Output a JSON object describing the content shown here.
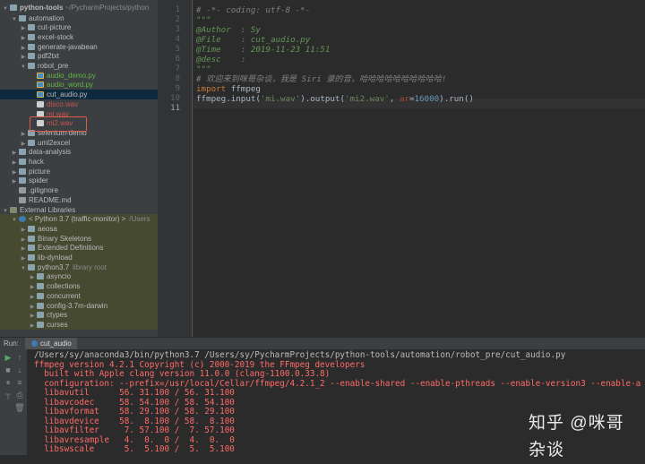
{
  "project": {
    "root": {
      "name": "python-tools",
      "path": "~/PycharmProjects/python"
    },
    "tree": [
      {
        "label": "automation",
        "indent": 1,
        "kind": "folder",
        "open": true
      },
      {
        "label": "cut-picture",
        "indent": 2,
        "kind": "folder",
        "open": false
      },
      {
        "label": "excel-stock",
        "indent": 2,
        "kind": "folder",
        "open": false
      },
      {
        "label": "generate-javabean",
        "indent": 2,
        "kind": "folder",
        "open": false
      },
      {
        "label": "pdf2txt",
        "indent": 2,
        "kind": "folder",
        "open": false
      },
      {
        "label": "robot_pre",
        "indent": 2,
        "kind": "folder",
        "open": true
      },
      {
        "label": "audio_demo.py",
        "indent": 3,
        "kind": "py",
        "color": "green"
      },
      {
        "label": "audio_word.py",
        "indent": 3,
        "kind": "py",
        "color": "green"
      },
      {
        "label": "cut_audio.py",
        "indent": 3,
        "kind": "py",
        "color": "normal",
        "selected": true
      },
      {
        "label": "disco.wav",
        "indent": 3,
        "kind": "wav",
        "color": "red"
      },
      {
        "label": "mi.wav",
        "indent": 3,
        "kind": "wav",
        "color": "red"
      },
      {
        "label": "mi2.wav",
        "indent": 3,
        "kind": "wav",
        "color": "red"
      },
      {
        "label": "selenium-demo",
        "indent": 2,
        "kind": "folder",
        "open": false
      },
      {
        "label": "uml2excel",
        "indent": 2,
        "kind": "folder",
        "open": false
      },
      {
        "label": "data-analysis",
        "indent": 1,
        "kind": "folder",
        "open": false
      },
      {
        "label": "hack",
        "indent": 1,
        "kind": "folder",
        "open": false
      },
      {
        "label": "picture",
        "indent": 1,
        "kind": "folder",
        "open": false
      },
      {
        "label": "spider",
        "indent": 1,
        "kind": "folder",
        "open": false
      },
      {
        "label": ".gitignore",
        "indent": 1,
        "kind": "txt",
        "leaf": true
      },
      {
        "label": "README.md",
        "indent": 1,
        "kind": "txt",
        "leaf": true
      },
      {
        "label": "External Libraries",
        "indent": 0,
        "kind": "lib",
        "open": true
      },
      {
        "label": "< Python 3.7 (traffic-monitor) >",
        "extra": "/Users",
        "indent": 1,
        "kind": "pyenv",
        "open": true
      },
      {
        "label": "aeosa",
        "indent": 2,
        "kind": "folder",
        "open": false
      },
      {
        "label": "Binary Skeletons",
        "indent": 2,
        "kind": "folder",
        "open": false
      },
      {
        "label": "Extended Definitions",
        "indent": 2,
        "kind": "folder",
        "open": false
      },
      {
        "label": "lib-dynload",
        "indent": 2,
        "kind": "folder",
        "open": false
      },
      {
        "label": "python3.7",
        "extra": "library root",
        "indent": 2,
        "kind": "folder",
        "open": true
      },
      {
        "label": "asyncio",
        "indent": 3,
        "kind": "folder",
        "open": false
      },
      {
        "label": "collections",
        "indent": 3,
        "kind": "folder",
        "open": false
      },
      {
        "label": "concurrent",
        "indent": 3,
        "kind": "folder",
        "open": false
      },
      {
        "label": "config-3.7m-darwin",
        "indent": 3,
        "kind": "folder",
        "open": false
      },
      {
        "label": "ctypes",
        "indent": 3,
        "kind": "folder",
        "open": false
      },
      {
        "label": "curses",
        "indent": 3,
        "kind": "folder",
        "open": false
      }
    ]
  },
  "editor": {
    "line_numbers": [
      "1",
      "2",
      "3",
      "4",
      "5",
      "6",
      "7",
      "8",
      "9",
      "10",
      "11"
    ],
    "current_line": "11",
    "lines": [
      [
        {
          "t": "# -*- coding: utf-8 -*-",
          "c": "comment"
        }
      ],
      [
        {
          "t": "\"\"\"",
          "c": "doc"
        }
      ],
      [
        {
          "t": "@Author  ",
          "c": "meta"
        },
        {
          "t": ": Sy",
          "c": "meta"
        }
      ],
      [
        {
          "t": "@File    ",
          "c": "meta"
        },
        {
          "t": ": cut_audio.py",
          "c": "meta"
        }
      ],
      [
        {
          "t": "@Time    ",
          "c": "meta"
        },
        {
          "t": ": 2019-11-23 11:51",
          "c": "meta"
        }
      ],
      [
        {
          "t": "@desc    ",
          "c": "meta"
        },
        {
          "t": ":",
          "c": "meta"
        }
      ],
      [
        {
          "t": "\"\"\"",
          "c": "doc"
        }
      ],
      [
        {
          "t": "# 欢迎来到咪哥杂谈，我是 Siri 录的音，哈哈哈哈哈哈哈哈哈哈!",
          "c": "comment"
        }
      ],
      [
        {
          "t": "import",
          "c": "kw"
        },
        {
          "t": " ffmpeg",
          "c": "plain"
        }
      ],
      [
        {
          "t": "ffmpeg.input(",
          "c": "plain"
        },
        {
          "t": "'mi.wav'",
          "c": "str"
        },
        {
          "t": ").output(",
          "c": "plain"
        },
        {
          "t": "'mi2.wav'",
          "c": "str"
        },
        {
          "t": ", ",
          "c": "plain"
        },
        {
          "t": "ar",
          "c": "param"
        },
        {
          "t": "=",
          "c": "plain"
        },
        {
          "t": "16000",
          "c": "num"
        },
        {
          "t": ").run()",
          "c": "plain"
        }
      ],
      [
        {
          "t": "",
          "c": "plain"
        }
      ]
    ]
  },
  "run": {
    "label": "Run:",
    "tab": "cut_audio",
    "console": [
      {
        "t": "/Users/sy/anaconda3/bin/python3.7 /Users/sy/PycharmProjects/python-tools/automation/robot_pre/cut_audio.py",
        "c": "cmd"
      },
      {
        "t": "ffmpeg version 4.2.1 Copyright (c) 2000-2019 the FFmpeg developers",
        "c": "err"
      },
      {
        "t": "  built with Apple clang version 11.0.0 (clang-1100.0.33.8)",
        "c": "err"
      },
      {
        "t": "  configuration: --prefix=/usr/local/Cellar/ffmpeg/4.2.1_2 --enable-shared --enable-pthreads --enable-version3 --enable-a",
        "c": "err"
      },
      {
        "t": "  libavutil      56. 31.100 / 56. 31.100",
        "c": "err"
      },
      {
        "t": "  libavcodec     58. 54.100 / 58. 54.100",
        "c": "err"
      },
      {
        "t": "  libavformat    58. 29.100 / 58. 29.100",
        "c": "err"
      },
      {
        "t": "  libavdevice    58.  8.100 / 58.  8.100",
        "c": "err"
      },
      {
        "t": "  libavfilter     7. 57.100 /  7. 57.100",
        "c": "err"
      },
      {
        "t": "  libavresample   4.  0.  0 /  4.  0.  0",
        "c": "err"
      },
      {
        "t": "  libswscale      5.  5.100 /  5.  5.100",
        "c": "err"
      }
    ]
  },
  "watermark": "知乎 @咪哥杂谈",
  "colors": {
    "accent_red": "#e05a4a",
    "selection": "#0d293e",
    "console_error": "#ff6b68"
  }
}
